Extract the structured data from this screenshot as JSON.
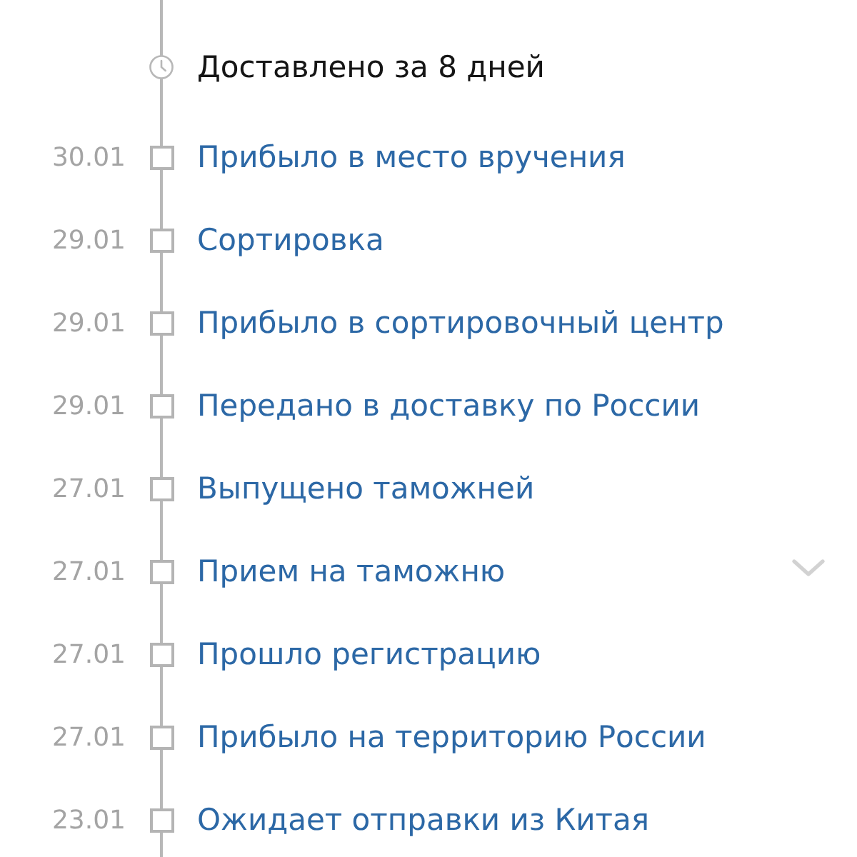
{
  "summary": {
    "text": "Доставлено за 8 дней"
  },
  "events": [
    {
      "date": "30.01",
      "title": "Прибыло в место вручения"
    },
    {
      "date": "29.01",
      "title": "Сортировка"
    },
    {
      "date": "29.01",
      "title": "Прибыло в сортировочный центр"
    },
    {
      "date": "29.01",
      "title": "Передано в доставку по России"
    },
    {
      "date": "27.01",
      "title": "Выпущено таможней"
    },
    {
      "date": "27.01",
      "title": "Прием на таможню"
    },
    {
      "date": "27.01",
      "title": "Прошло регистрацию"
    },
    {
      "date": "27.01",
      "title": "Прибыло на территорию России"
    },
    {
      "date": "23.01",
      "title": "Ожидает отправки из Китая"
    }
  ]
}
